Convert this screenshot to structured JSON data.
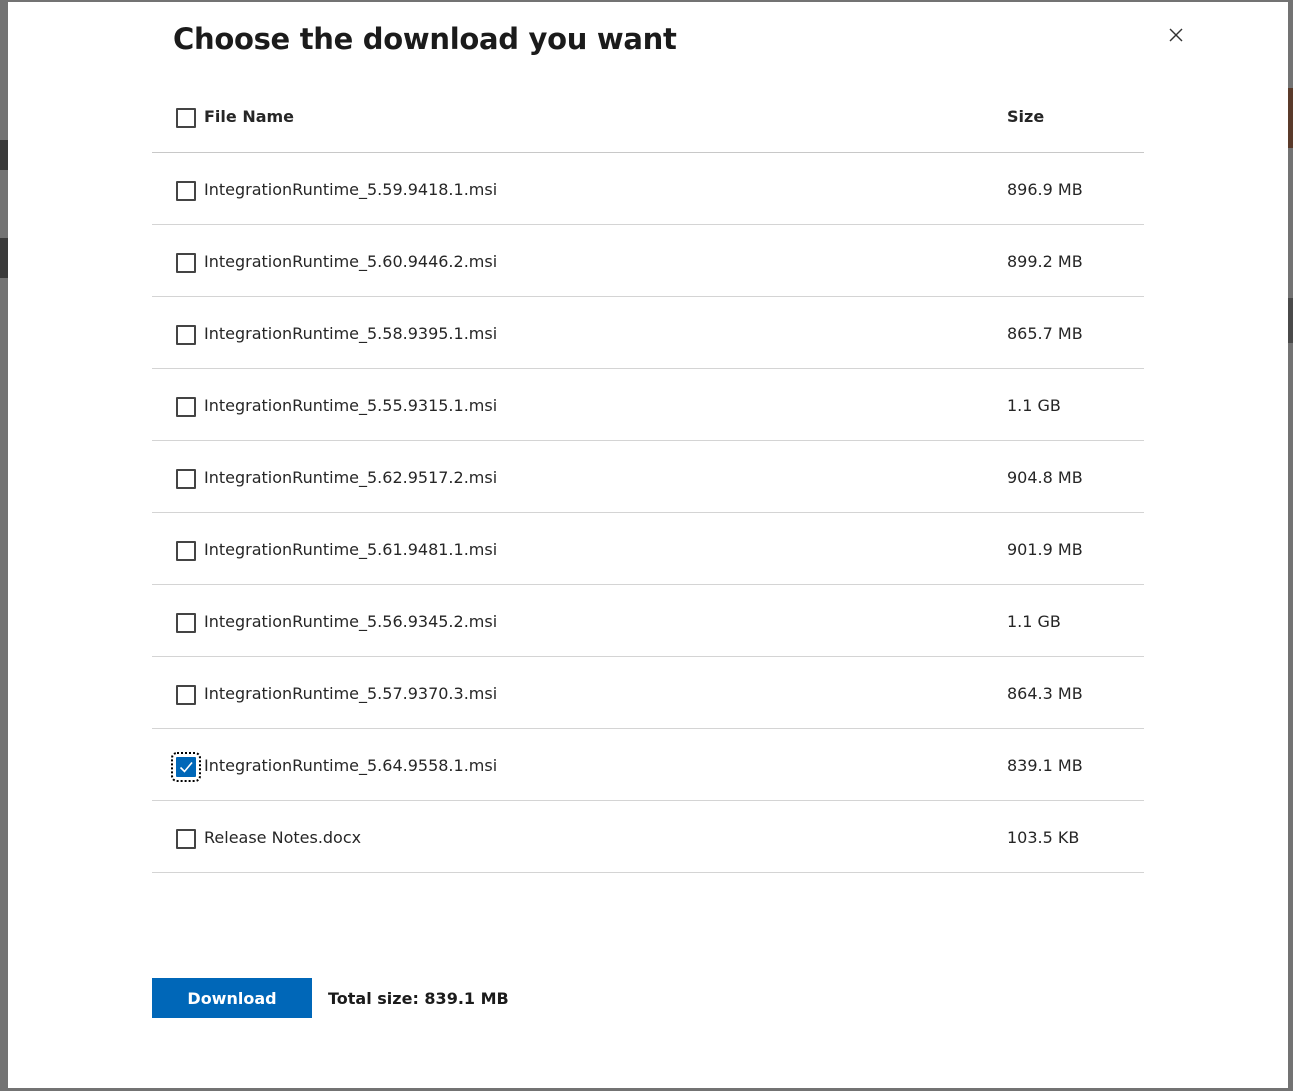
{
  "dialog": {
    "title": "Choose the download you want",
    "close_icon": "close-icon"
  },
  "table": {
    "headers": {
      "file_name": "File Name",
      "size": "Size"
    },
    "rows": [
      {
        "name": "IntegrationRuntime_5.59.9418.1.msi",
        "size": "896.9 MB",
        "checked": false
      },
      {
        "name": "IntegrationRuntime_5.60.9446.2.msi",
        "size": "899.2 MB",
        "checked": false
      },
      {
        "name": "IntegrationRuntime_5.58.9395.1.msi",
        "size": "865.7 MB",
        "checked": false
      },
      {
        "name": "IntegrationRuntime_5.55.9315.1.msi",
        "size": "1.1 GB",
        "checked": false
      },
      {
        "name": "IntegrationRuntime_5.62.9517.2.msi",
        "size": "904.8 MB",
        "checked": false
      },
      {
        "name": "IntegrationRuntime_5.61.9481.1.msi",
        "size": "901.9 MB",
        "checked": false
      },
      {
        "name": "IntegrationRuntime_5.56.9345.2.msi",
        "size": "1.1 GB",
        "checked": false
      },
      {
        "name": "IntegrationRuntime_5.57.9370.3.msi",
        "size": "864.3 MB",
        "checked": false
      },
      {
        "name": "IntegrationRuntime_5.64.9558.1.msi",
        "size": "839.1 MB",
        "checked": true
      },
      {
        "name": "Release Notes.docx",
        "size": "103.5 KB",
        "checked": false
      }
    ]
  },
  "footer": {
    "download_label": "Download",
    "total_size": "Total size: 839.1 MB"
  },
  "colors": {
    "accent": "#0067b8",
    "overlay": "#737373"
  }
}
